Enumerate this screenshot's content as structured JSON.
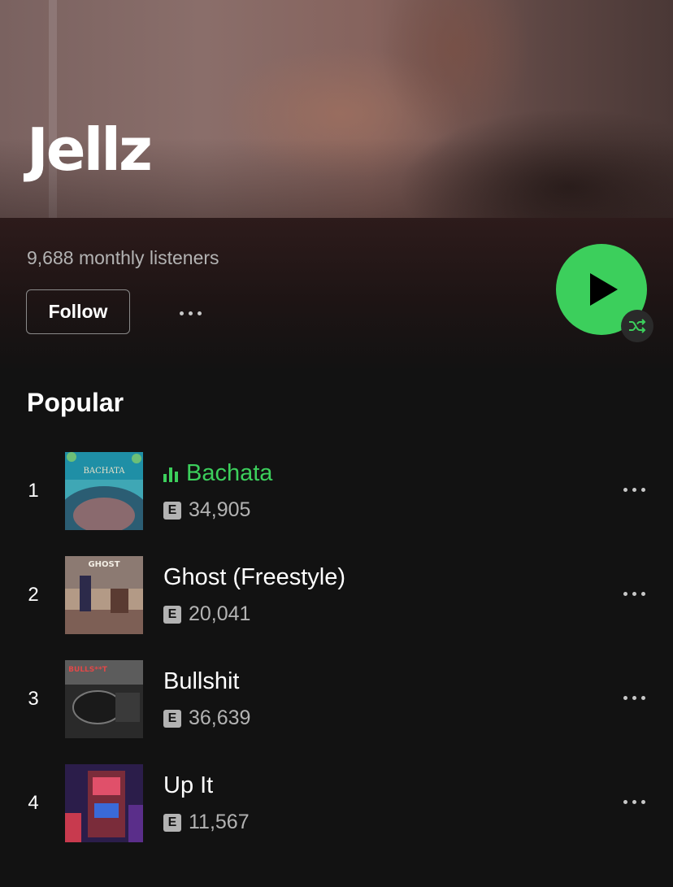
{
  "artist": {
    "name": "Jellz",
    "monthly_listeners": "9,688 monthly listeners"
  },
  "actions": {
    "follow_label": "Follow",
    "more_icon": "more-horizontal-icon",
    "play_icon": "play-icon",
    "shuffle_icon": "shuffle-icon"
  },
  "popular": {
    "title": "Popular",
    "tracks": [
      {
        "number": "1",
        "title": "Bachata",
        "plays": "34,905",
        "explicit": "E",
        "playing": true
      },
      {
        "number": "2",
        "title": "Ghost (Freestyle)",
        "plays": "20,041",
        "explicit": "E",
        "playing": false
      },
      {
        "number": "3",
        "title": "Bullshit",
        "plays": "36,639",
        "explicit": "E",
        "playing": false
      },
      {
        "number": "4",
        "title": "Up It",
        "plays": "11,567",
        "explicit": "E",
        "playing": false
      }
    ]
  },
  "cover_text": {
    "bachata": "BACHATA",
    "ghost": "GHOST",
    "bullshit": "BULLS**T"
  },
  "colors": {
    "accent": "#3ccf5c",
    "background": "#121212",
    "secondary_text": "#b3b3b3"
  }
}
